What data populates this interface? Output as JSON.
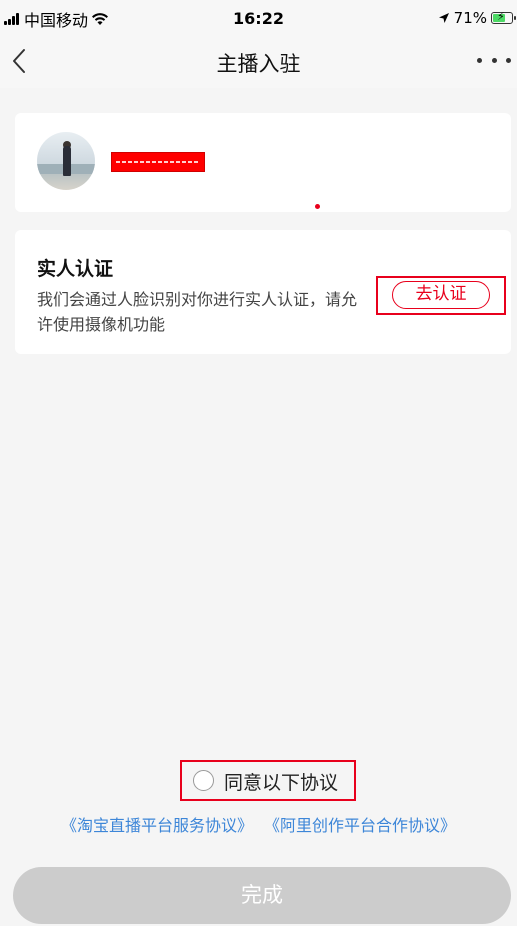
{
  "status_bar": {
    "carrier": "中国移动",
    "time": "16:22",
    "battery_percent": "71%",
    "battery_level": 0.71,
    "icons": [
      "signal-icon",
      "wifi-icon",
      "location-arrow-icon",
      "battery-icon"
    ]
  },
  "nav": {
    "title": "主播入驻",
    "back_icon": "chevron-left-icon",
    "more_icon": "more-horizontal-icon"
  },
  "profile": {
    "avatar": "avatar",
    "name_redacted": true
  },
  "verification": {
    "title": "实人认证",
    "description": "我们会通过人脸识别对你进行实人认证，请允许使用摄像机功能",
    "button_label": "去认证"
  },
  "agreement": {
    "label": "同意以下协议",
    "checked": false,
    "links": [
      "《淘宝直播平台服务协议》",
      "《阿里创作平台合作协议》"
    ]
  },
  "footer": {
    "done_label": "完成"
  },
  "colors": {
    "accent": "#e8001c",
    "link": "#3d86d8",
    "disabled_button": "#cccccc",
    "background": "#f5f5f5"
  }
}
